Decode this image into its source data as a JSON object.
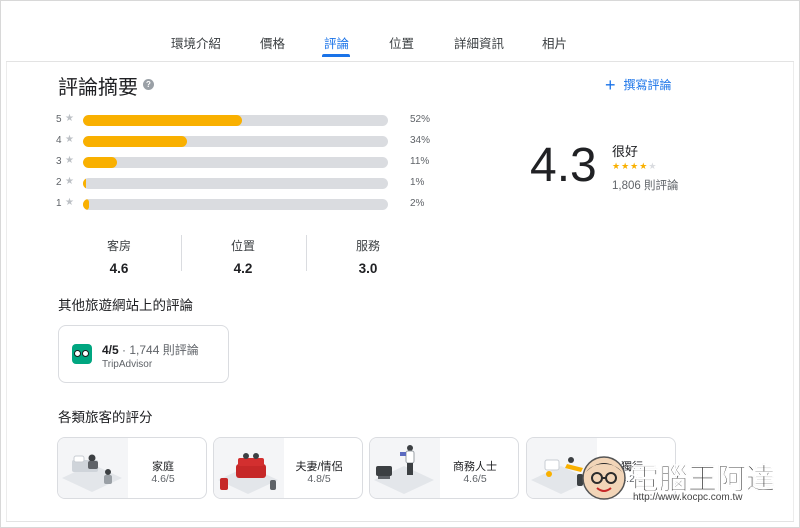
{
  "tabs": [
    {
      "label": "環境介紹",
      "active": false
    },
    {
      "label": "價格",
      "active": false
    },
    {
      "label": "評論",
      "active": true
    },
    {
      "label": "位置",
      "active": false
    },
    {
      "label": "詳細資訊",
      "active": false
    },
    {
      "label": "相片",
      "active": false
    }
  ],
  "summary": {
    "title": "評論摘要",
    "help_icon": "question-circle-icon",
    "write_review_label": "撰寫評論",
    "write_review_icon": "plus-icon",
    "histogram": [
      {
        "stars": "5",
        "percent_label": "52%",
        "fill": 0.52
      },
      {
        "stars": "4",
        "percent_label": "34%",
        "fill": 0.34
      },
      {
        "stars": "3",
        "percent_label": "11%",
        "fill": 0.11
      },
      {
        "stars": "2",
        "percent_label": "1%",
        "fill": 0.01
      },
      {
        "stars": "1",
        "percent_label": "2%",
        "fill": 0.02
      }
    ],
    "overall_score": "4.3",
    "overall_label": "很好",
    "overall_stars": 4,
    "review_count": "1,806 則評論"
  },
  "aspects": [
    {
      "label": "客房",
      "value": "4.6"
    },
    {
      "label": "位置",
      "value": "4.2"
    },
    {
      "label": "服務",
      "value": "3.0"
    }
  ],
  "other_sites": {
    "title": "其他旅遊網站上的評論",
    "items": [
      {
        "rating": "4/5",
        "separator": " · ",
        "count": "1,744 則評論",
        "site": "TripAdvisor",
        "icon": "tripadvisor-owl-icon"
      }
    ]
  },
  "traveler_types": {
    "title": "各類旅客的評分",
    "items": [
      {
        "type": "家庭",
        "score": "4.6/5"
      },
      {
        "type": "夫妻/情侶",
        "score": "4.8/5"
      },
      {
        "type": "商務人士",
        "score": "4.6/5"
      },
      {
        "type": "獨行",
        "score": "4.2/5"
      }
    ]
  },
  "watermark": {
    "brand": "電腦王阿達",
    "url": "http://www.kocpc.com.tw"
  },
  "colors": {
    "accent": "#1a73e8",
    "star": "#f9b000",
    "track": "#dadce0",
    "tripadvisor": "#00a680"
  }
}
